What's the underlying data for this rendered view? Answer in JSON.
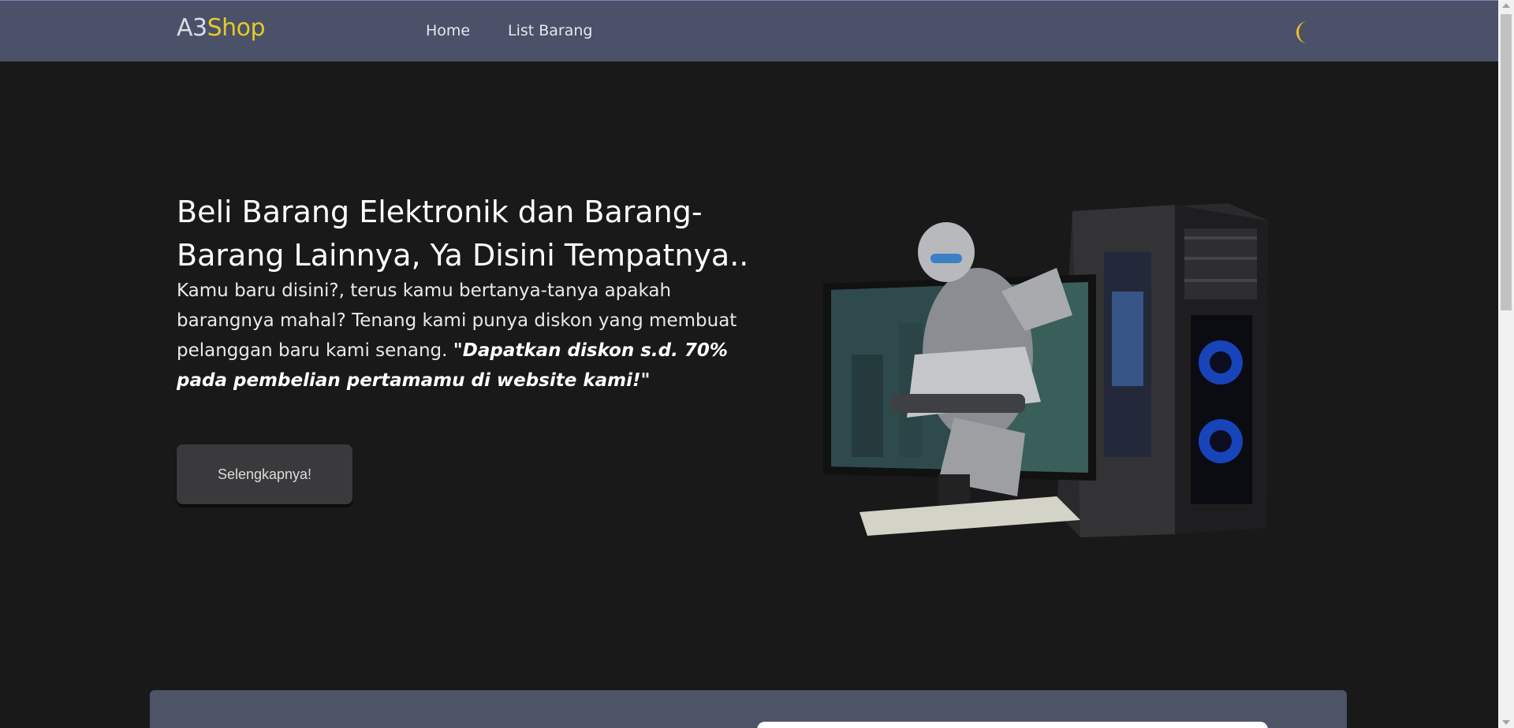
{
  "navbar": {
    "brand_prefix": "A3",
    "brand_suffix": "Shop",
    "links": [
      {
        "label": "Home"
      },
      {
        "label": "List Barang"
      }
    ],
    "theme_icon": "moon-icon"
  },
  "hero": {
    "title": "Beli Barang Elektronik dan Barang-Barang Lainnya, Ya Disini Tempatnya..",
    "text": "Kamu baru disini?, terus kamu bertanya-tanya apakah barangnya mahal? Tenang kami punya diskon yang membuat pelanggan baru kami senang.",
    "highlight": "\"Dapatkan diskon s.d. 70% pada pembelian pertamamu di website kami!\"",
    "cta_label": "Selengkapnya!",
    "image": "gaming-pc-monitor-image"
  },
  "colors": {
    "background": "#19191a",
    "navbar": "#4a5168",
    "brand_accent": "#e5c928",
    "button": "#3a393b",
    "moon": "#f2c12e"
  }
}
